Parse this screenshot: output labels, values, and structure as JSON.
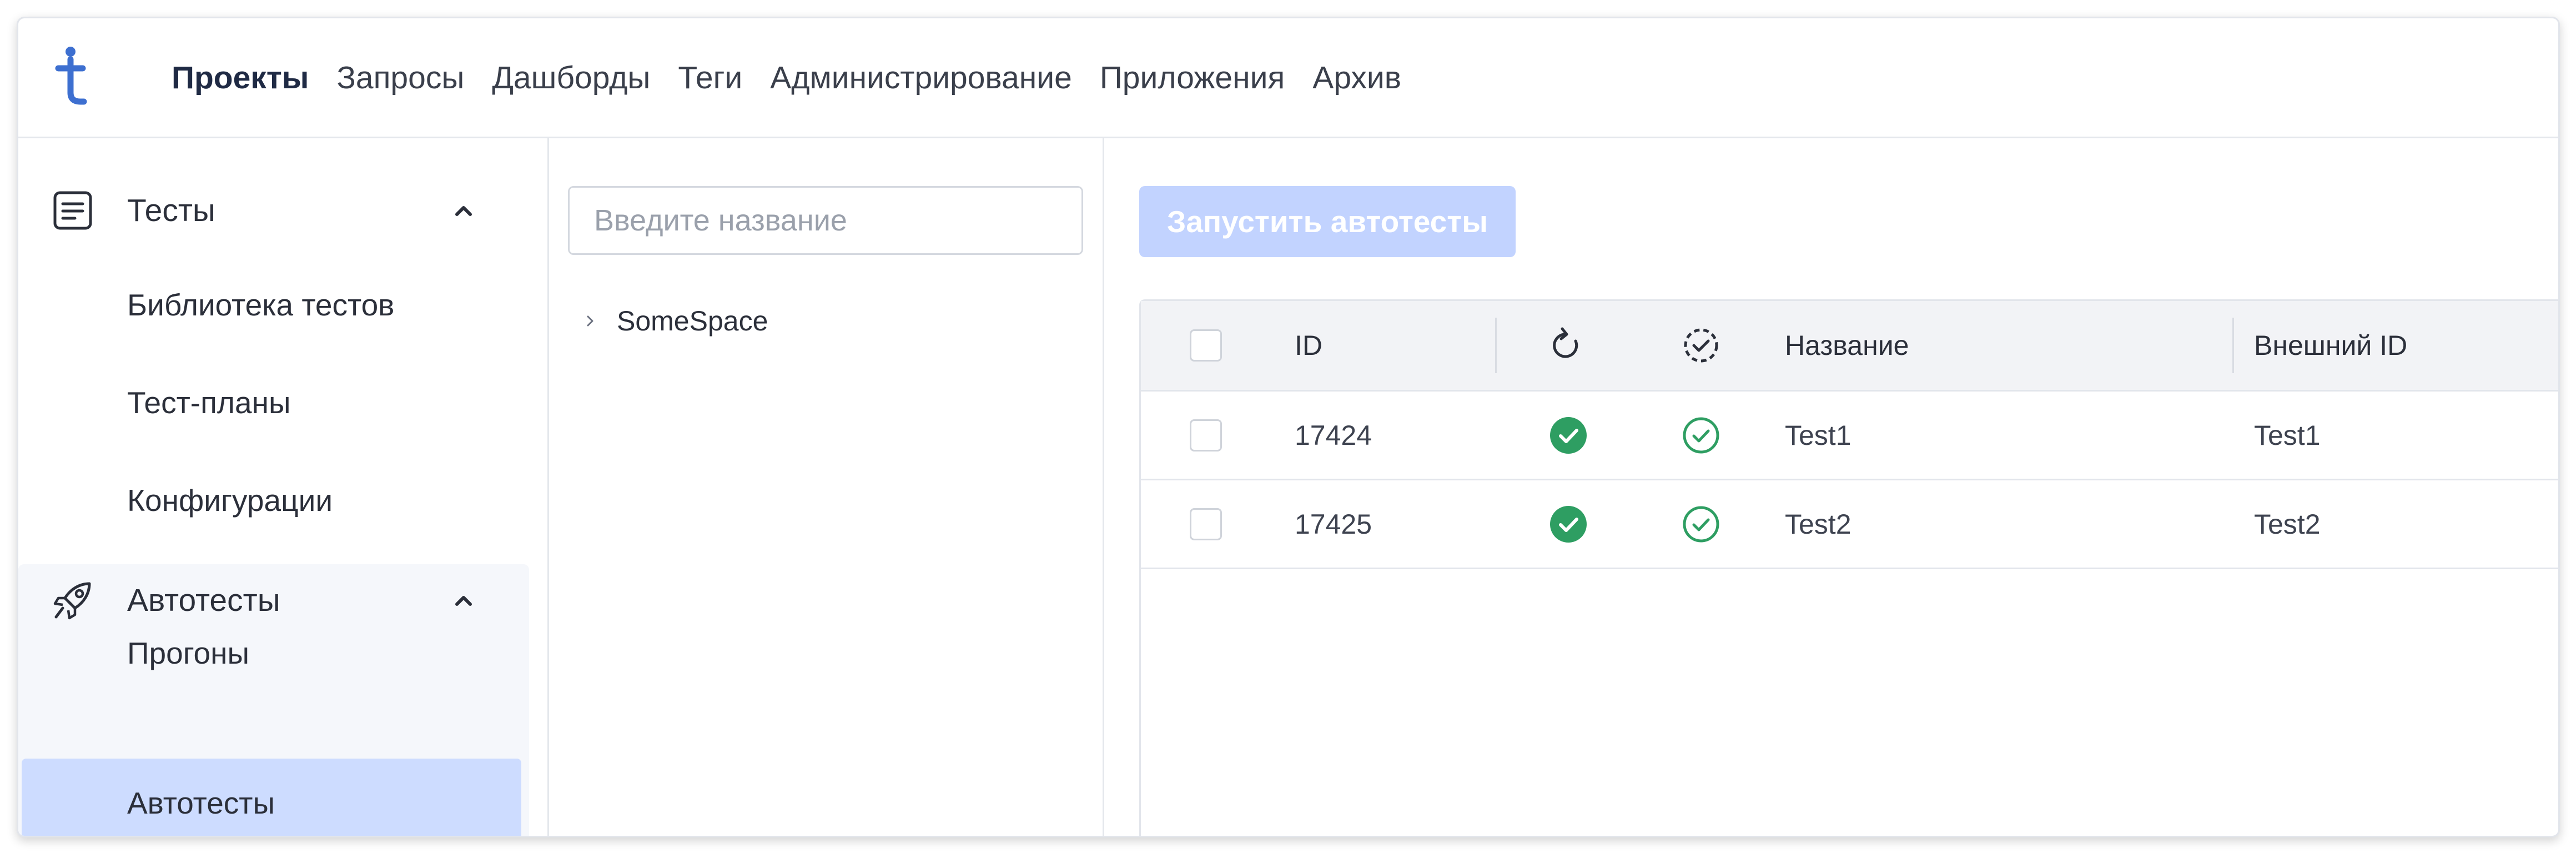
{
  "nav": {
    "items": [
      {
        "label": "Проекты",
        "active": true
      },
      {
        "label": "Запросы",
        "active": false
      },
      {
        "label": "Дашборды",
        "active": false
      },
      {
        "label": "Теги",
        "active": false
      },
      {
        "label": "Администрирование",
        "active": false
      },
      {
        "label": "Приложения",
        "active": false
      },
      {
        "label": "Архив",
        "active": false
      }
    ]
  },
  "sidebar": {
    "tests": {
      "label": "Тесты",
      "icon": "document-icon",
      "items": [
        "Библиотека тестов",
        "Тест-планы",
        "Конфигурации"
      ]
    },
    "autotests": {
      "label": "Автотесты",
      "icon": "rocket-icon",
      "items": [
        "Прогоны",
        "Автотесты"
      ],
      "selected": "Автотесты"
    }
  },
  "tree": {
    "search_placeholder": "Введите название",
    "nodes": [
      "SomeSpace"
    ]
  },
  "main": {
    "run_button": "Запустить автотесты",
    "table": {
      "headers": {
        "id": "ID",
        "runs_icon": "refresh-icon",
        "status_icon": "dashed-check-icon",
        "name": "Название",
        "external_id": "Внешний ID"
      },
      "rows": [
        {
          "id": "17424",
          "name": "Test1",
          "external_id": "Test1"
        },
        {
          "id": "17425",
          "name": "Test2",
          "external_id": "Test2"
        }
      ]
    }
  },
  "colors": {
    "accent": "#3d6fd0",
    "selected_bg": "#cddcff",
    "button_disabled": "#c2d3ff",
    "success": "#2e9e62",
    "header_bg": "#f2f3f6"
  }
}
